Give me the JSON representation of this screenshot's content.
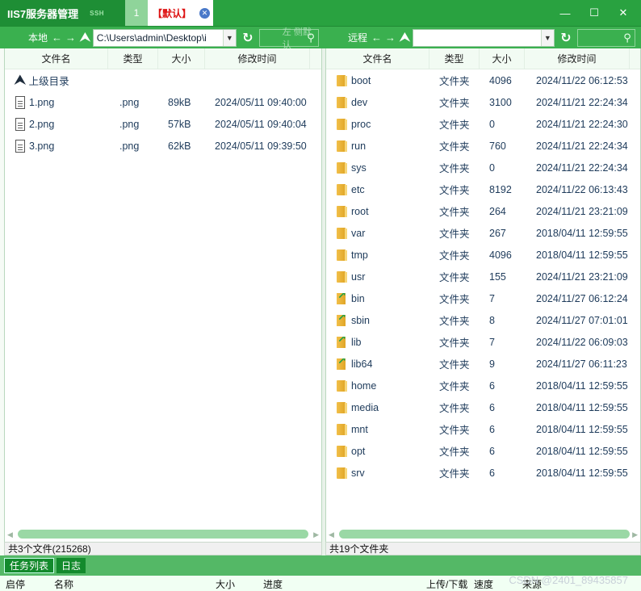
{
  "titlebar": {
    "app_title": "IIS7服务器管理",
    "ssh_tag": "SSH",
    "tab_number": "1",
    "tab_default": "【默认】",
    "minimize": "—",
    "maximize": "☐",
    "close": "✕"
  },
  "toolbar": {
    "local_label": "本地",
    "remote_label": "远程",
    "back_arrow": "←",
    "forward_arrow": "→",
    "up_arrow": "⮝",
    "local_path": "C:\\Users\\admin\\Desktop\\i",
    "remote_path": "",
    "local_search_placeholder": "左    侧默认",
    "remote_search_placeholder": ""
  },
  "local_panel": {
    "columns": [
      "文件名",
      "类型",
      "大小",
      "修改时间"
    ],
    "parent_dir": "上级目录",
    "files": [
      {
        "name": "1.png",
        "type": ".png",
        "size": "89kB",
        "modified": "2024/05/11 09:40:00"
      },
      {
        "name": "2.png",
        "type": ".png",
        "size": "57kB",
        "modified": "2024/05/11 09:40:04"
      },
      {
        "name": "3.png",
        "type": ".png",
        "size": "62kB",
        "modified": "2024/05/11 09:39:50"
      }
    ],
    "status": "共3个文件(215268)"
  },
  "remote_panel": {
    "columns": [
      "文件名",
      "类型",
      "大小",
      "修改时间"
    ],
    "files": [
      {
        "name": "boot",
        "type": "文件夹",
        "size": "4096",
        "modified": "2024/11/22 06:12:53",
        "link": false
      },
      {
        "name": "dev",
        "type": "文件夹",
        "size": "3100",
        "modified": "2024/11/21 22:24:34",
        "link": false
      },
      {
        "name": "proc",
        "type": "文件夹",
        "size": "0",
        "modified": "2024/11/21 22:24:30",
        "link": false
      },
      {
        "name": "run",
        "type": "文件夹",
        "size": "760",
        "modified": "2024/11/21 22:24:34",
        "link": false
      },
      {
        "name": "sys",
        "type": "文件夹",
        "size": "0",
        "modified": "2024/11/21 22:24:34",
        "link": false
      },
      {
        "name": "etc",
        "type": "文件夹",
        "size": "8192",
        "modified": "2024/11/22 06:13:43",
        "link": false
      },
      {
        "name": "root",
        "type": "文件夹",
        "size": "264",
        "modified": "2024/11/21 23:21:09",
        "link": false
      },
      {
        "name": "var",
        "type": "文件夹",
        "size": "267",
        "modified": "2018/04/11 12:59:55",
        "link": false
      },
      {
        "name": "tmp",
        "type": "文件夹",
        "size": "4096",
        "modified": "2018/04/11 12:59:55",
        "link": false
      },
      {
        "name": "usr",
        "type": "文件夹",
        "size": "155",
        "modified": "2024/11/21 23:21:09",
        "link": false
      },
      {
        "name": "bin",
        "type": "文件夹",
        "size": "7",
        "modified": "2024/11/27 06:12:24",
        "link": true
      },
      {
        "name": "sbin",
        "type": "文件夹",
        "size": "8",
        "modified": "2024/11/27 07:01:01",
        "link": true
      },
      {
        "name": "lib",
        "type": "文件夹",
        "size": "7",
        "modified": "2024/11/22 06:09:03",
        "link": true
      },
      {
        "name": "lib64",
        "type": "文件夹",
        "size": "9",
        "modified": "2024/11/27 06:11:23",
        "link": true
      },
      {
        "name": "home",
        "type": "文件夹",
        "size": "6",
        "modified": "2018/04/11 12:59:55",
        "link": false
      },
      {
        "name": "media",
        "type": "文件夹",
        "size": "6",
        "modified": "2018/04/11 12:59:55",
        "link": false
      },
      {
        "name": "mnt",
        "type": "文件夹",
        "size": "6",
        "modified": "2018/04/11 12:59:55",
        "link": false
      },
      {
        "name": "opt",
        "type": "文件夹",
        "size": "6",
        "modified": "2018/04/11 12:59:55",
        "link": false
      },
      {
        "name": "srv",
        "type": "文件夹",
        "size": "6",
        "modified": "2018/04/11 12:59:55",
        "link": false
      }
    ],
    "status": "共19个文件夹"
  },
  "bottom": {
    "tabs": [
      "任务列表",
      "日志"
    ],
    "task_columns": {
      "start_stop": "启停",
      "name": "名称",
      "size": "大小",
      "progress": "进度",
      "direction": "上传/下载",
      "speed": "速度",
      "source": "来源"
    },
    "watermark": "CSDN @2401_89435857"
  }
}
